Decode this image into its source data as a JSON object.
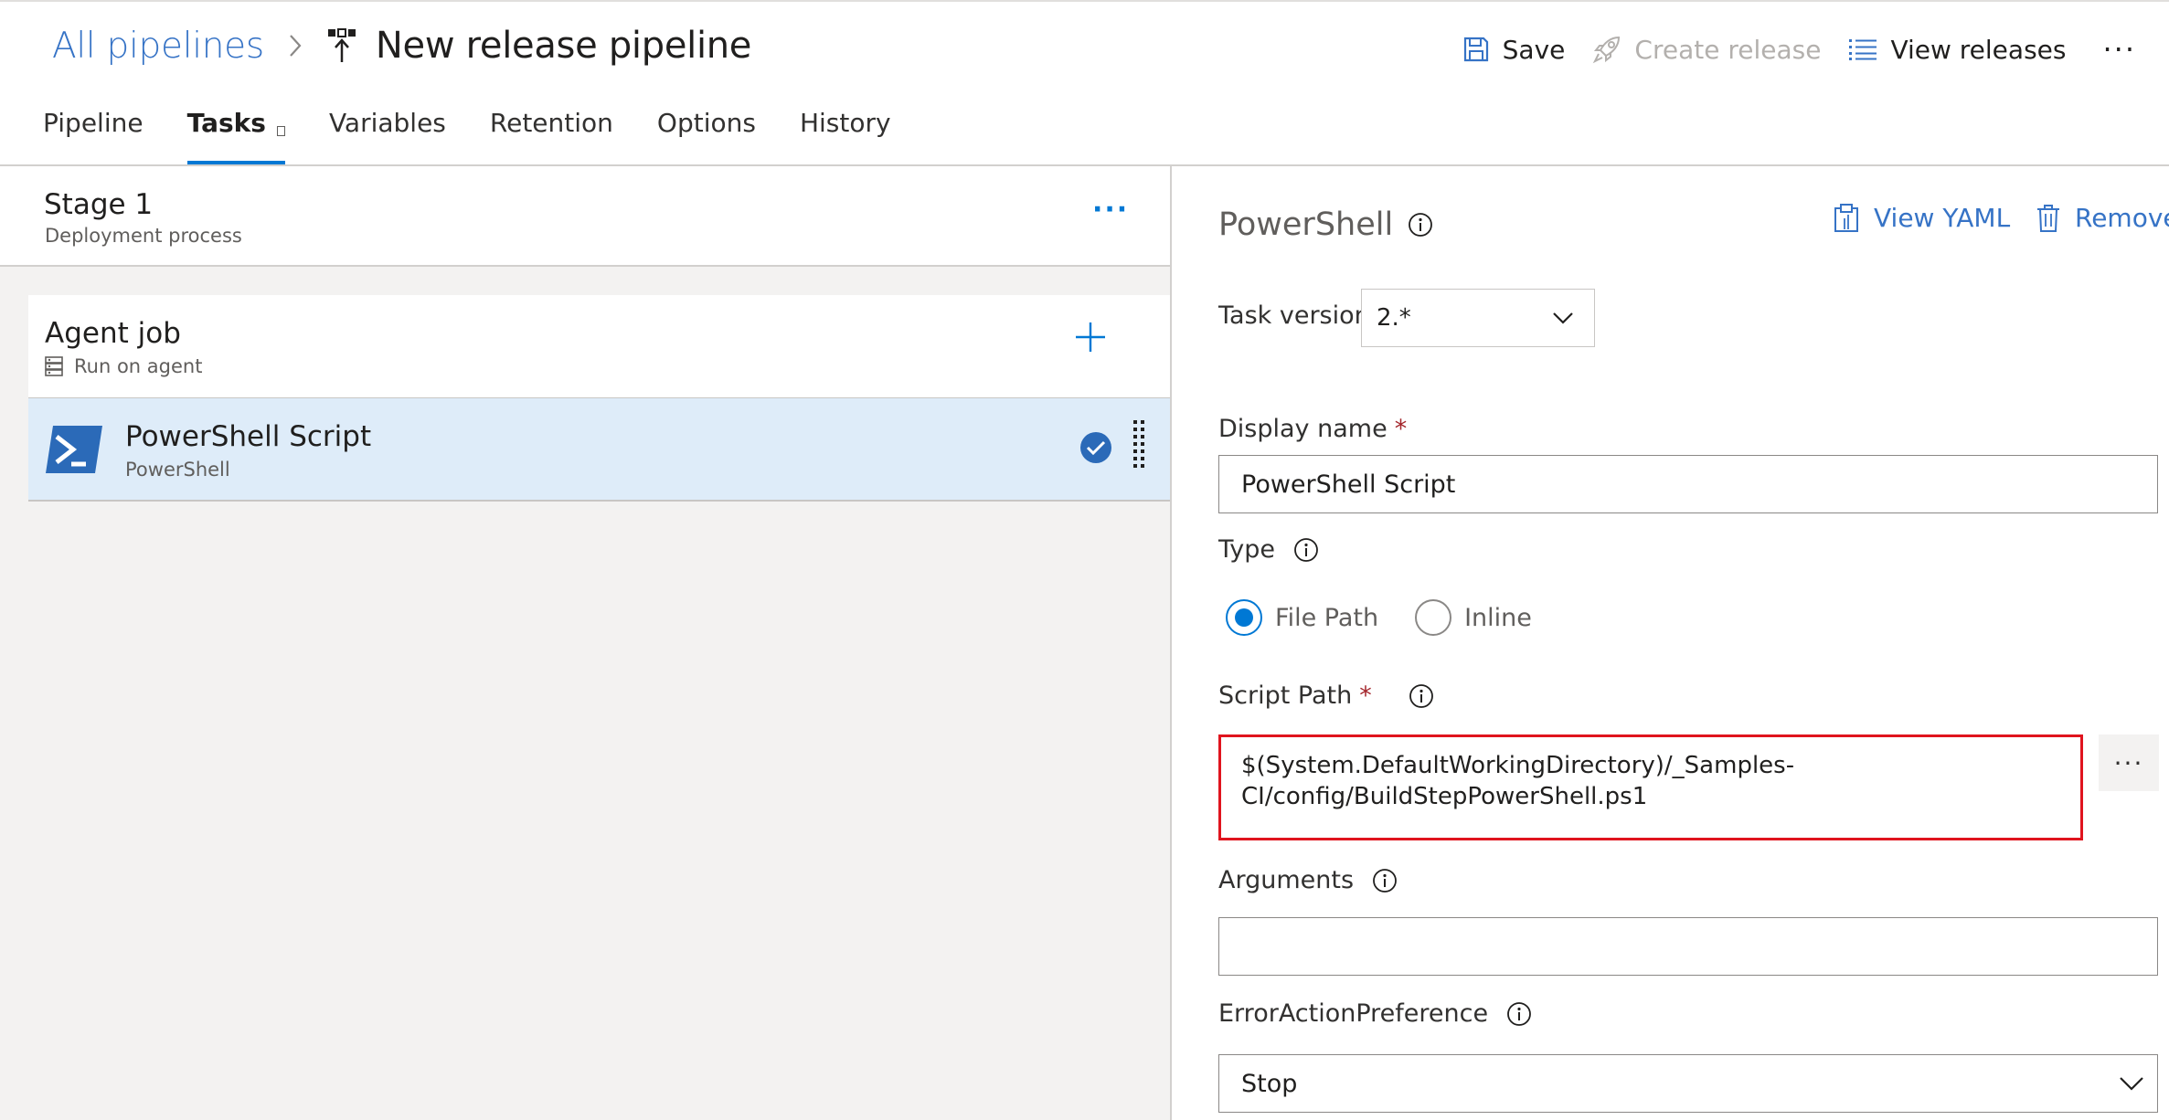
{
  "header": {
    "breadcrumb_root": "All pipelines",
    "title": "New release pipeline"
  },
  "actions": {
    "save": "Save",
    "create_release": "Create release",
    "view_releases": "View releases",
    "more": "···"
  },
  "tabs": [
    {
      "label": "Pipeline",
      "active": false
    },
    {
      "label": "Tasks",
      "active": true
    },
    {
      "label": "Variables",
      "active": false
    },
    {
      "label": "Retention",
      "active": false
    },
    {
      "label": "Options",
      "active": false
    },
    {
      "label": "History",
      "active": false
    }
  ],
  "stage": {
    "title": "Stage 1",
    "subtitle": "Deployment process",
    "more": "···"
  },
  "agent_job": {
    "title": "Agent job",
    "subtitle": "Run on agent"
  },
  "task": {
    "title": "PowerShell Script",
    "subtitle": "PowerShell"
  },
  "panel": {
    "title": "PowerShell",
    "view_yaml": "View YAML",
    "remove": "Remove",
    "task_version_label": "Task version",
    "task_version_value": "2.*",
    "display_name_label": "Display name",
    "required_mark": "*",
    "display_name_value": "PowerShell Script",
    "type_label": "Type",
    "type_options": [
      {
        "label": "File Path",
        "checked": true
      },
      {
        "label": "Inline",
        "checked": false
      }
    ],
    "script_path_label": "Script Path",
    "script_path_line1": "$(System.DefaultWorkingDirectory)/_Samples-",
    "script_path_line2": "CI/config/BuildStepPowerShell.ps1",
    "browse": "···",
    "arguments_label": "Arguments",
    "arguments_value": "",
    "error_pref_label": "ErrorActionPreference",
    "error_pref_value": "Stop"
  },
  "colors": {
    "accent": "#0078d4",
    "link": "#3673c6",
    "highlight_border": "#e0141e",
    "selected_row": "#deecf9",
    "required": "#a4262c"
  }
}
